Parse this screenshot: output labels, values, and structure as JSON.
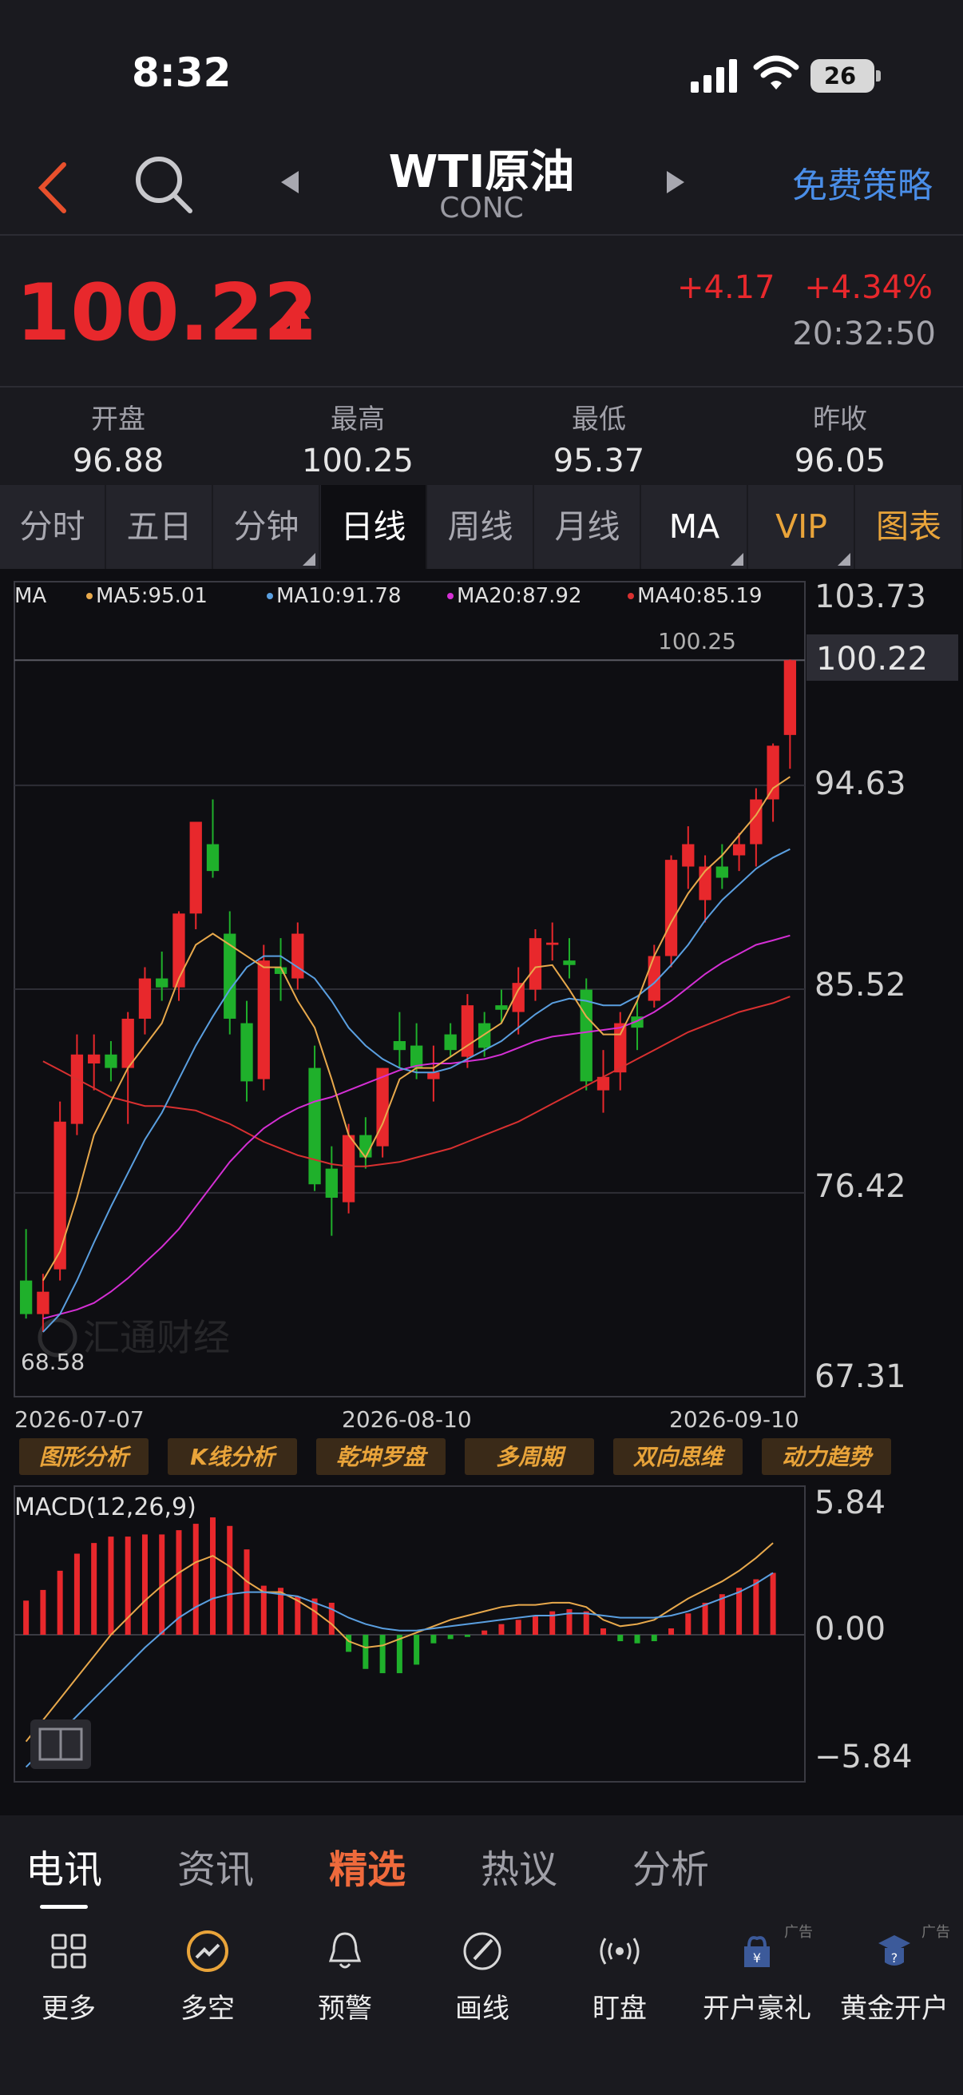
{
  "status": {
    "time": "8:32",
    "battery": "26"
  },
  "nav": {
    "title": "WTI原油",
    "subtitle": "CONC",
    "strategy": "免费策略"
  },
  "quote": {
    "price": "100.22",
    "change": "+4.17",
    "change_pct": "+4.34%",
    "time": "20:32:50"
  },
  "stats": [
    {
      "label": "开盘",
      "value": "96.88"
    },
    {
      "label": "最高",
      "value": "100.25"
    },
    {
      "label": "最低",
      "value": "95.37"
    },
    {
      "label": "昨收",
      "value": "96.05"
    }
  ],
  "tabs": [
    "分时",
    "五日",
    "分钟",
    "日线",
    "周线",
    "月线",
    "MA",
    "VIP",
    "图表"
  ],
  "ma_legend": {
    "ma": "MA",
    "ma5": "MA5:95.01",
    "ma10": "MA10:91.78",
    "ma20": "MA20:87.92",
    "ma40": "MA40:85.19"
  },
  "price_axis": [
    "103.73",
    "100.22",
    "94.63",
    "85.52",
    "76.42",
    "67.31"
  ],
  "high_label": "100.25",
  "low_label": "68.58",
  "watermark": "汇通财经",
  "dates": [
    "2026-07-07",
    "2026-08-10",
    "2026-09-10"
  ],
  "analysis_buttons": [
    "图形分析",
    "K线分析",
    "乾坤罗盘",
    "多周期",
    "双向思维",
    "动力趋势"
  ],
  "macd": {
    "label": "MACD(12,26,9)",
    "axis": [
      "5.84",
      "0.00",
      "−5.84"
    ]
  },
  "bottom_tabs": [
    "电讯",
    "资讯",
    "精选",
    "热议",
    "分析"
  ],
  "toolbar": [
    {
      "label": "更多",
      "icon": "grid-icon"
    },
    {
      "label": "多空",
      "icon": "trend-icon"
    },
    {
      "label": "预警",
      "icon": "bell-icon"
    },
    {
      "label": "画线",
      "icon": "draw-line-icon"
    },
    {
      "label": "盯盘",
      "icon": "broadcast-icon"
    },
    {
      "label": "开户豪礼",
      "icon": "gift-icon",
      "ad": "广告"
    },
    {
      "label": "黄金开户",
      "icon": "gold-account-icon",
      "ad": "广告"
    }
  ],
  "colors": {
    "up": "#e8282c",
    "down": "#1fb02b",
    "ma5": "#e8a94c",
    "ma10": "#5a9fe0",
    "ma20": "#d42fd4",
    "ma40": "#d83030",
    "accent_blue": "#4a8ee8",
    "gold": "#e9a43a"
  },
  "chart_data": {
    "type": "candlestick",
    "ylim": [
      67.31,
      103.73
    ],
    "candles": [
      [
        72.5,
        74.8,
        70.8,
        71.0
      ],
      [
        71.0,
        72.8,
        70.2,
        72.0
      ],
      [
        73.0,
        80.5,
        72.5,
        79.6
      ],
      [
        79.5,
        83.5,
        79.0,
        82.6
      ],
      [
        82.2,
        83.5,
        81.0,
        82.6
      ],
      [
        82.6,
        83.2,
        81.4,
        82.0
      ],
      [
        82.0,
        84.5,
        79.5,
        84.2
      ],
      [
        84.2,
        86.5,
        83.5,
        86.0
      ],
      [
        86.0,
        87.2,
        85.0,
        85.6
      ],
      [
        85.6,
        89.0,
        85.0,
        88.9
      ],
      [
        88.9,
        93.0,
        88.2,
        93.0
      ],
      [
        92.0,
        94.0,
        90.5,
        90.8
      ],
      [
        88.0,
        89.0,
        83.5,
        84.2
      ],
      [
        84.0,
        85.0,
        80.5,
        81.4
      ],
      [
        81.5,
        87.5,
        81.0,
        86.8
      ],
      [
        86.5,
        87.8,
        85.0,
        86.2
      ],
      [
        86.0,
        88.5,
        85.5,
        88.0
      ],
      [
        82.0,
        83.0,
        76.5,
        76.8
      ],
      [
        77.5,
        78.5,
        74.5,
        76.2
      ],
      [
        76.0,
        79.5,
        75.5,
        79.0
      ],
      [
        79.0,
        79.8,
        77.5,
        78.0
      ],
      [
        78.5,
        82.0,
        78.0,
        82.0
      ],
      [
        83.2,
        84.5,
        82.0,
        82.8
      ],
      [
        83.0,
        84.0,
        81.5,
        82.0
      ],
      [
        81.5,
        83.0,
        80.5,
        81.8
      ],
      [
        83.5,
        84.0,
        82.5,
        82.8
      ],
      [
        82.5,
        85.3,
        82.0,
        84.8
      ],
      [
        84.0,
        84.5,
        82.5,
        82.9
      ],
      [
        84.8,
        85.5,
        84.0,
        84.6
      ],
      [
        84.5,
        86.5,
        83.5,
        85.8
      ],
      [
        85.5,
        88.2,
        85.0,
        87.8
      ],
      [
        87.5,
        88.5,
        86.8,
        87.6
      ],
      [
        86.8,
        87.8,
        86.0,
        86.6
      ],
      [
        85.5,
        86.0,
        81.0,
        81.4
      ],
      [
        81.0,
        82.8,
        80.0,
        81.6
      ],
      [
        81.8,
        84.5,
        81.0,
        84.0
      ],
      [
        84.3,
        85.0,
        82.8,
        83.8
      ],
      [
        85.0,
        87.5,
        84.7,
        87.0
      ],
      [
        87.0,
        91.5,
        86.5,
        91.3
      ],
      [
        91.0,
        92.8,
        90.0,
        92.0
      ],
      [
        89.5,
        91.5,
        88.5,
        91.0
      ],
      [
        91.0,
        92.0,
        90.0,
        90.5
      ],
      [
        91.5,
        92.5,
        90.8,
        92.0
      ],
      [
        92.0,
        94.5,
        91.0,
        94.0
      ],
      [
        94.0,
        96.5,
        93.0,
        96.4
      ],
      [
        96.88,
        100.25,
        95.37,
        100.22
      ]
    ],
    "ma5": [
      72.5,
      73.8,
      76.2,
      79.0,
      80.5,
      82.0,
      83.0,
      84.0,
      86.0,
      87.5,
      88.0,
      87.5,
      87.0,
      86.5,
      86.5,
      85.0,
      83.8,
      81.5,
      79.0,
      78.0,
      79.5,
      81.5,
      82.0,
      82.0,
      82.5,
      83.0,
      83.5,
      84.0,
      85.5,
      86.5,
      86.6,
      85.5,
      84.3,
      83.5,
      83.5,
      85.0,
      87.0,
      88.5,
      89.8,
      90.8,
      91.5,
      92.4,
      93.3,
      94.5,
      95.01
    ],
    "ma10": [
      70.2,
      71.0,
      72.5,
      74.2,
      75.8,
      77.3,
      78.8,
      80.0,
      81.5,
      83.0,
      84.3,
      85.5,
      86.5,
      87.0,
      87.0,
      86.5,
      86.0,
      85.0,
      83.8,
      83.0,
      82.4,
      82.0,
      81.8,
      81.8,
      82.0,
      82.4,
      82.8,
      83.2,
      83.8,
      84.4,
      84.9,
      85.1,
      85.0,
      84.8,
      84.8,
      85.2,
      85.8,
      86.6,
      87.5,
      88.6,
      89.5,
      90.2,
      90.9,
      91.4,
      91.78
    ],
    "ma20": [
      70.8,
      71.0,
      71.2,
      71.5,
      72.0,
      72.6,
      73.3,
      74.0,
      74.8,
      75.8,
      76.8,
      77.8,
      78.6,
      79.3,
      79.8,
      80.2,
      80.5,
      80.7,
      81.0,
      81.3,
      81.6,
      81.9,
      82.1,
      82.2,
      82.2,
      82.3,
      82.4,
      82.6,
      82.9,
      83.2,
      83.4,
      83.5,
      83.6,
      83.7,
      83.8,
      84.1,
      84.5,
      85.0,
      85.6,
      86.2,
      86.7,
      87.1,
      87.5,
      87.7,
      87.92
    ],
    "ma40": [
      82.3,
      81.9,
      81.5,
      81.1,
      80.7,
      80.5,
      80.3,
      80.3,
      80.2,
      80.1,
      79.8,
      79.5,
      79.1,
      78.7,
      78.4,
      78.1,
      77.9,
      77.7,
      77.6,
      77.6,
      77.7,
      77.8,
      78.0,
      78.2,
      78.4,
      78.7,
      79.0,
      79.3,
      79.6,
      80.0,
      80.4,
      80.8,
      81.2,
      81.6,
      82.0,
      82.4,
      82.8,
      83.2,
      83.6,
      83.9,
      84.2,
      84.5,
      84.7,
      84.9,
      85.19
    ],
    "macd_hist": [
      1.6,
      2.1,
      3.0,
      3.8,
      4.3,
      4.6,
      4.6,
      4.7,
      4.7,
      4.9,
      5.2,
      5.5,
      5.1,
      4.0,
      2.3,
      2.2,
      1.8,
      1.7,
      1.5,
      -0.8,
      -1.6,
      -1.8,
      -1.8,
      -1.4,
      -0.4,
      -0.2,
      -0.1,
      0.2,
      0.5,
      0.7,
      0.9,
      1.1,
      1.2,
      1.1,
      0.3,
      -0.3,
      -0.4,
      -0.3,
      0.3,
      1.0,
      1.5,
      1.9,
      2.2,
      2.6,
      2.9
    ],
    "dif": [
      -5.0,
      -4.0,
      -3.0,
      -2.0,
      -1.0,
      0.0,
      0.8,
      1.6,
      2.3,
      2.9,
      3.4,
      3.7,
      3.2,
      2.5,
      2.0,
      2.0,
      1.6,
      1.1,
      0.5,
      -0.3,
      -0.6,
      -0.5,
      -0.2,
      0.1,
      0.4,
      0.7,
      0.9,
      1.1,
      1.3,
      1.4,
      1.4,
      1.5,
      1.5,
      1.3,
      0.7,
      0.4,
      0.5,
      0.7,
      1.2,
      1.7,
      2.1,
      2.5,
      3.0,
      3.6,
      4.3
    ],
    "dea": [
      -6.2,
      -5.4,
      -4.6,
      -3.8,
      -3.0,
      -2.2,
      -1.4,
      -0.6,
      0.1,
      0.8,
      1.3,
      1.7,
      1.9,
      2.0,
      2.0,
      1.9,
      1.8,
      1.5,
      1.2,
      0.8,
      0.5,
      0.3,
      0.2,
      0.2,
      0.3,
      0.4,
      0.5,
      0.6,
      0.7,
      0.8,
      0.9,
      0.9,
      1.0,
      1.0,
      0.9,
      0.8,
      0.8,
      0.8,
      0.9,
      1.1,
      1.4,
      1.7,
      2.0,
      2.4,
      2.9
    ],
    "macd_ylim": [
      -5.84,
      5.84
    ]
  }
}
